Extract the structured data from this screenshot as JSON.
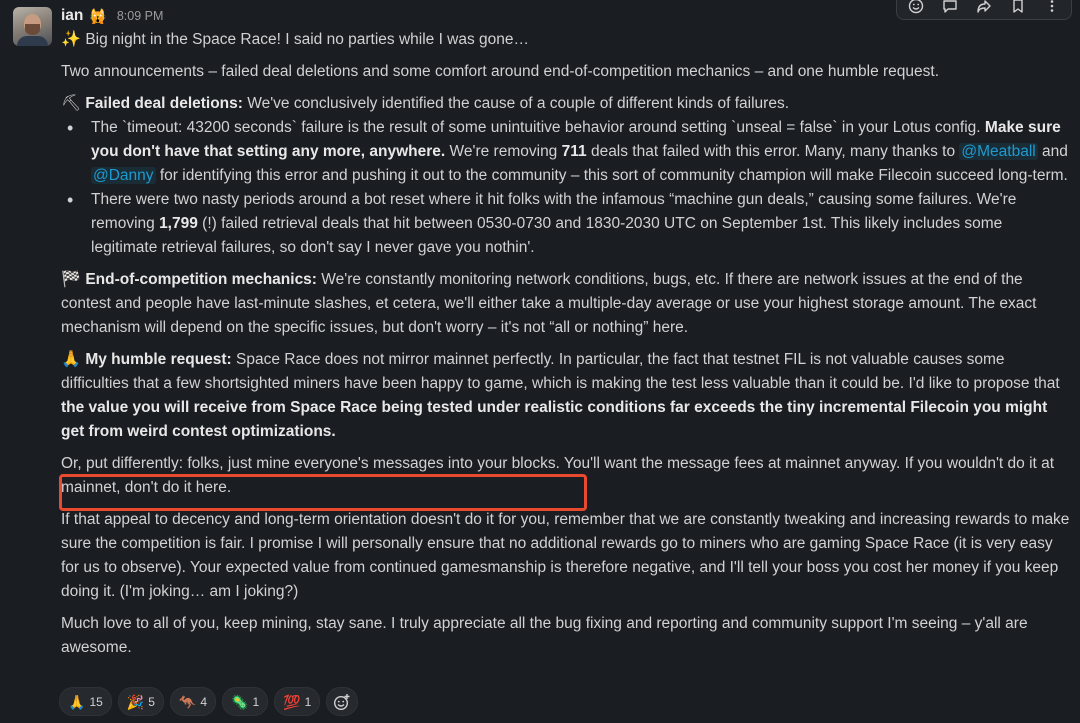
{
  "message": {
    "author": "ian",
    "status_emoji": "🙀",
    "time": "8:09 PM",
    "intro_emoji": "✨",
    "intro": "Big night in the Space Race! I said no parties while I was gone…",
    "summary": "Two announcements – failed deal deletions and some comfort around end-of-competition mechanics – and one humble request.",
    "failed": {
      "emoji": "⛏",
      "heading": "Failed deal deletions:",
      "text": " We've conclusively identified the cause of a couple of different kinds of failures.",
      "bullet1": {
        "a": "The `timeout: 43200 seconds` failure is the result of some unintuitive behavior around setting `unseal = false` in your Lotus config. ",
        "b": "Make sure you don't have that setting any more, anywhere.",
        "c": " We're removing ",
        "d": "711",
        "e": " deals that failed with this error. Many, many thanks to ",
        "mention1": "@Meatball",
        "f": " and ",
        "mention2": "@Danny",
        "g": " for identifying this error and pushing it out to the community – this sort of community champion will make Filecoin succeed long-term."
      },
      "bullet2": {
        "a": "There were two nasty periods around a bot reset where it hit folks with the infamous “machine gun deals,” causing some failures. We're removing ",
        "b": "1,799",
        "c": " (!) failed retrieval deals that hit between 0530-0730 and 1830-2030 UTC on September 1st. This likely includes some legitimate retrieval failures, so don't say I never gave you nothin'."
      }
    },
    "endcomp": {
      "emoji": "🏁",
      "heading": "End-of-competition mechanics:",
      "text": " We're constantly monitoring network conditions, bugs, etc. If there are network issues at the end of the contest and people have last-minute slashes, et cetera, we'll either take a multiple-day average or use your highest storage amount. The exact mechanism will depend on the specific issues, but don't worry – it's not “all or nothing” here."
    },
    "request": {
      "emoji": "🙏",
      "heading": "My humble request:",
      "a": " Space Race does not mirror mainnet perfectly. In particular, the fact that testnet FIL is not valuable causes some difficulties that a few shortsighted miners have been happy to game, which is making the test less valuable than it could be. I'd like to propose that ",
      "b": "the value you will receive from Space Race being tested under realistic conditions far exceeds the tiny incremental Filecoin you might get from weird contest optimizations."
    },
    "put_differently": "Or, put differently: folks, just mine everyone's messages into your blocks. You'll want the message fees at mainnet anyway. If you wouldn't do it at mainnet, don't do it here.",
    "appeal": "If that appeal to decency and long-term orientation doesn't do it for you, remember that we are constantly tweaking and increasing rewards to make sure the competition is fair. I promise I will personally ensure that no additional rewards go to miners who are gaming Space Race (it is very easy for us to observe). Your expected value from continued gamesmanship is therefore negative, and I'll tell your boss you cost her money if you keep doing it. (I'm joking… am I joking?)",
    "closing": "Much love to all of you, keep mining, stay sane. I truly appreciate all the bug fixing and reporting and community support I'm seeing – y'all are awesome."
  },
  "reactions": [
    {
      "emoji": "🙏",
      "count": "15"
    },
    {
      "emoji": "🎉",
      "count": "5"
    },
    {
      "emoji": "🦘",
      "count": "4"
    },
    {
      "emoji": "🦠",
      "count": "1"
    },
    {
      "emoji": "💯",
      "count": "1"
    }
  ],
  "add_reaction_icon": "add-reaction-icon",
  "toolbar_icons": [
    "emoji-icon",
    "reply-icon",
    "share-icon",
    "bookmark-icon",
    "more-icon"
  ],
  "colors": {
    "background": "#1a1d21",
    "text": "#d1d2d3",
    "mention": "#1d9bd1",
    "highlight": "#e8492f"
  }
}
